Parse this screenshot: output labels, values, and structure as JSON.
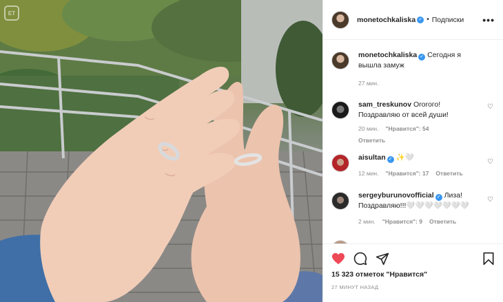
{
  "photo": {
    "watermark": "ЕТ"
  },
  "header": {
    "username": "monetochkaliska",
    "verified_mark": "✓",
    "separator": "•",
    "follow_label": "Подписки",
    "more_label": "•••"
  },
  "caption": {
    "username": "monetochkaliska",
    "text": "Сегодня я вышла замуж",
    "time": "27 мин."
  },
  "comments": [
    {
      "username": "sam_treskunov",
      "verified": false,
      "text": "Ororoго! Поздравляю от всей души!",
      "time": "20 мин.",
      "likes": "\"Нравится\": 54",
      "reply": "Ответить"
    },
    {
      "username": "aisultan",
      "verified": true,
      "text": "✨🤍",
      "time": "12 мин.",
      "likes": "\"Нравится\": 17",
      "reply": "Ответить"
    },
    {
      "username": "sergeyburunovofficial",
      "verified": true,
      "text": "Лиза! Поздравляю!!!🤍🤍🤍🤍🤍🤍🤍",
      "time": "2 мин.",
      "likes": "\"Нравится\": 9",
      "reply": "Ответить"
    }
  ],
  "actions": {
    "likes_text": "15 323 отметок \"Нравится\"",
    "posted_ago": "27 МИНУТ НАЗАД"
  },
  "colors": {
    "like_red": "#ed4956",
    "verified_blue": "#3897f0",
    "muted": "#8e8e8e"
  }
}
